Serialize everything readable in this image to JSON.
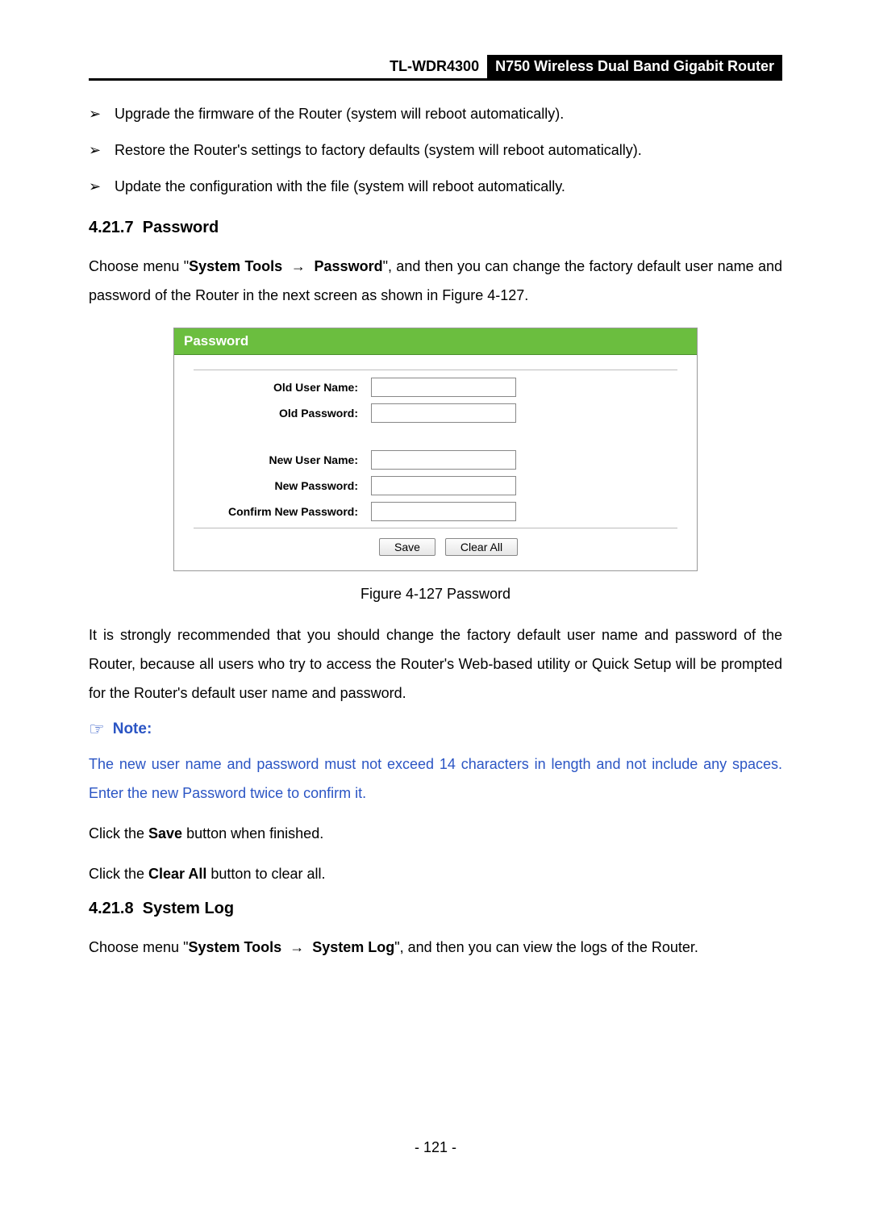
{
  "header": {
    "model": "TL-WDR4300",
    "title": "N750 Wireless Dual Band Gigabit Router"
  },
  "bullets": [
    "Upgrade the firmware of the Router (system will reboot automatically).",
    "Restore the Router's settings to factory defaults (system will reboot automatically).",
    "Update the configuration with the file (system will reboot automatically."
  ],
  "section1": {
    "number": "4.21.7",
    "title": "Password",
    "intro_pre": "Choose menu \"",
    "intro_menu_a": "System Tools",
    "intro_arrow": "→",
    "intro_menu_b": "Password",
    "intro_post": "\", and then you can change the factory default user name and password of the Router in the next screen as shown in Figure 4-127."
  },
  "panel": {
    "title": "Password",
    "labels": {
      "old_user": "Old User Name:",
      "old_pass": "Old Password:",
      "new_user": "New User Name:",
      "new_pass": "New Password:",
      "confirm": "Confirm New Password:"
    },
    "buttons": {
      "save": "Save",
      "clear": "Clear All"
    }
  },
  "figure_caption": "Figure 4-127 Password",
  "recommend": "It is strongly recommended that you should change the factory default user name and password of the Router, because all users who try to access the Router's Web-based utility or Quick Setup will be prompted for the Router's default user name and password.",
  "note": {
    "label": "Note:",
    "body": "The new user name and password must not exceed 14 characters in length and not include any spaces. Enter the new Password twice to confirm it."
  },
  "click_save_pre": "Click the ",
  "click_save_bold": "Save",
  "click_save_post": " button when finished.",
  "click_clear_pre": "Click the ",
  "click_clear_bold": "Clear All",
  "click_clear_post": " button to clear all.",
  "section2": {
    "number": "4.21.8",
    "title": "System Log",
    "intro_pre": "Choose menu \"",
    "intro_menu_a": "System Tools",
    "intro_arrow": "→",
    "intro_menu_b": "System Log",
    "intro_post": "\", and then you can view the logs of the Router."
  },
  "page_number": "- 121 -"
}
